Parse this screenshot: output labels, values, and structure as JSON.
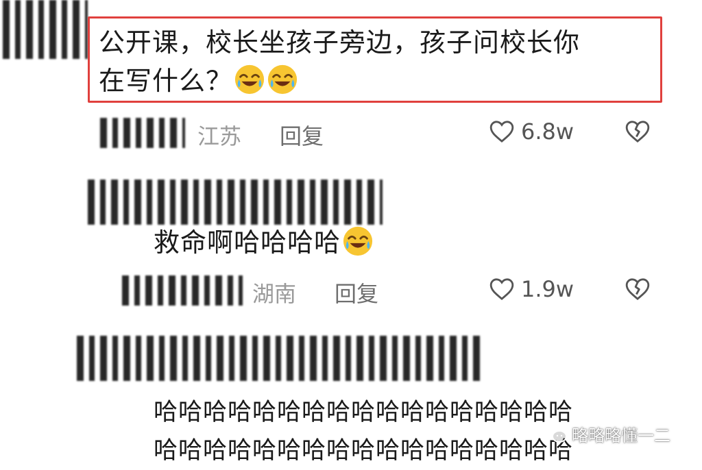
{
  "comment1": {
    "text_line1": "公开课，校长坐孩子旁边，孩子问校长你",
    "text_line2": "在写什么？",
    "emoji": [
      "laughing-crying-emoji",
      "laughing-crying-emoji"
    ],
    "location": "江苏",
    "reply_label": "回复",
    "likes": "6.8w"
  },
  "comment2": {
    "text": "救命啊哈哈哈哈",
    "emoji": [
      "laughing-crying-emoji"
    ],
    "location": "湖南",
    "reply_label": "回复",
    "likes": "1.9w"
  },
  "comment3": {
    "text_line1": "哈哈哈哈哈哈哈哈哈哈哈哈哈哈哈哈哈",
    "text_line2": "哈哈哈哈哈哈哈哈哈哈哈哈哈哈哈哈哈"
  },
  "watermark": {
    "text": "略略略懂一二",
    "icon": "wechat-icon"
  },
  "colors": {
    "highlight_border": "#e0403d",
    "meta_text": "#9a9a9a"
  }
}
